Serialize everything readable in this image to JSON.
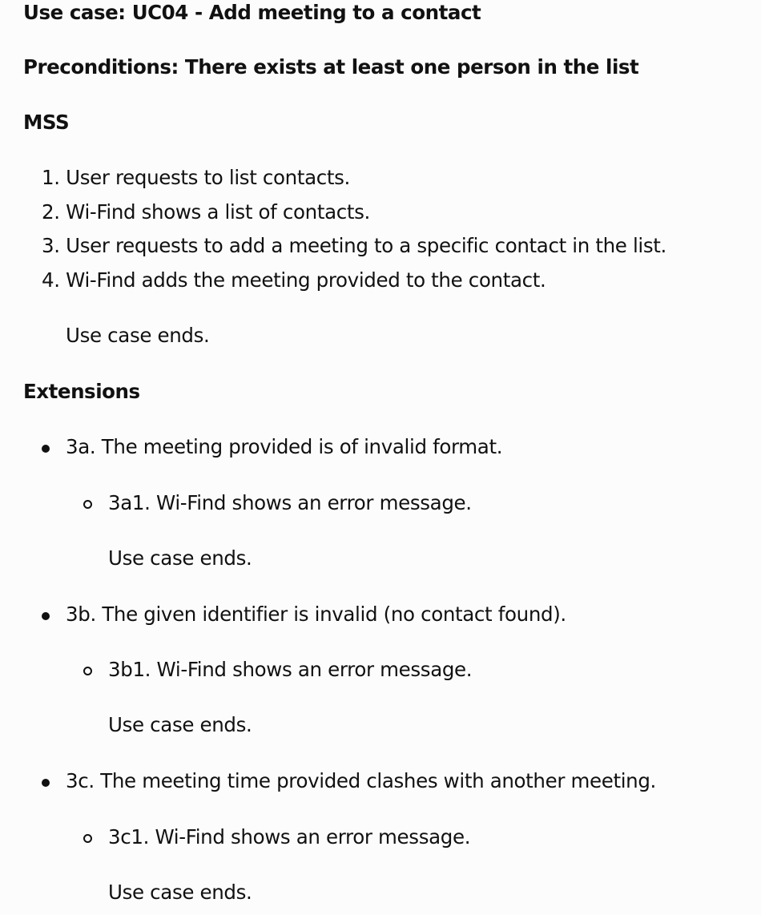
{
  "title": "Use case: UC04 - Add meeting to a contact",
  "preconditions": "Preconditions: There exists at least one person in the list",
  "mss_heading": "MSS",
  "mss_steps": [
    "1. User requests to list contacts.",
    "2. Wi-Find shows a list of contacts.",
    "3. User requests to add a meeting to a specific contact in the list.",
    "4. Wi-Find adds the meeting provided to the contact."
  ],
  "mss_end": "Use case ends.",
  "extensions_heading": "Extensions",
  "extensions": [
    {
      "label": "3a. The meeting provided is of invalid format.",
      "sub": "3a1. Wi-Find shows an error message.",
      "end": "Use case ends."
    },
    {
      "label": "3b. The given identifier is invalid (no contact found).",
      "sub": "3b1. Wi-Find shows an error message.",
      "end": "Use case ends."
    },
    {
      "label": "3c. The meeting time provided clashes with another meeting.",
      "sub": "3c1. Wi-Find shows an error message.",
      "end": "Use case ends."
    }
  ]
}
